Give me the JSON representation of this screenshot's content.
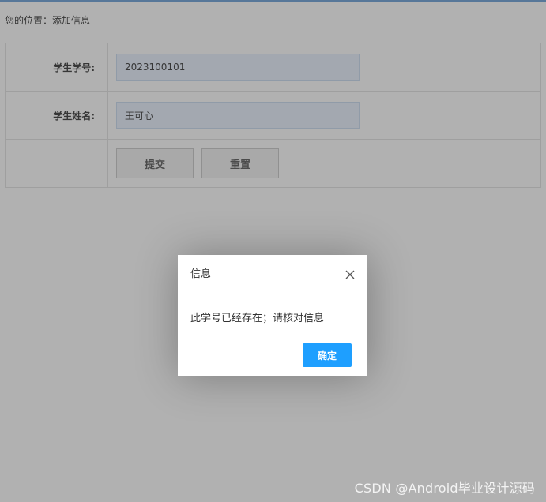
{
  "breadcrumb": {
    "text": "您的位置：添加信息"
  },
  "form": {
    "student_id_label": "学生学号:",
    "student_id_value": "2023100101",
    "student_name_label": "学生姓名:",
    "student_name_value": "王可心",
    "submit_label": "提交",
    "reset_label": "重置"
  },
  "dialog": {
    "title": "信息",
    "close_icon": "close-icon",
    "message": "此学号已经存在；请核对信息",
    "confirm_label": "确定"
  },
  "watermark": {
    "text": "CSDN @Android毕业设计源码"
  },
  "colors": {
    "top_bar": "#6a9fd8",
    "input_bg": "#e8f0fe",
    "confirm_button": "#1e9fff",
    "overlay": "rgba(60,60,60,0.4)"
  }
}
